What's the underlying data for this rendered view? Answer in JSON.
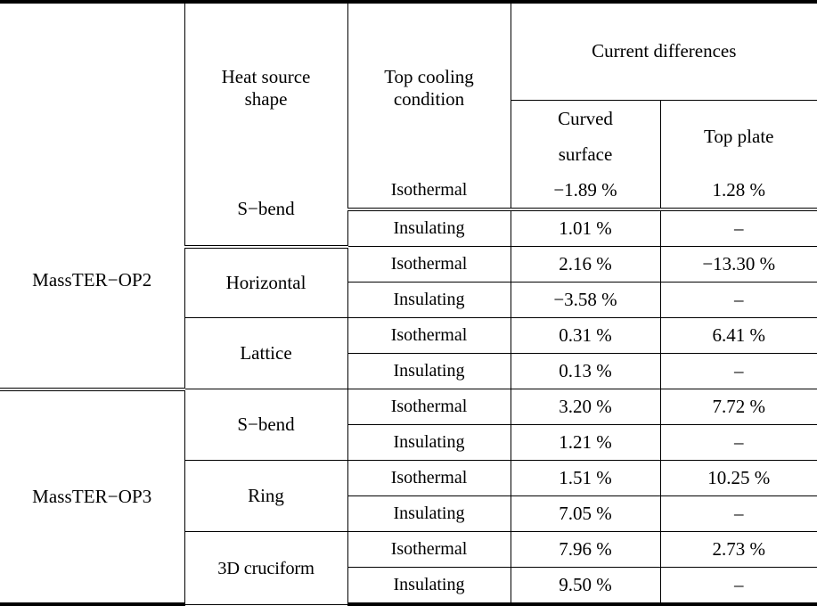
{
  "table": {
    "caption_present": false,
    "header": {
      "col_model": "",
      "col_shape": {
        "line1": "Heat  source",
        "line2": "shape"
      },
      "col_cooling": {
        "line1": "Top  cooling",
        "line2": "condition"
      },
      "group_current_differences": "Current  differences",
      "col_curved": {
        "line1": "Curved",
        "line2": "surface"
      },
      "col_topplate": "Top  plate"
    },
    "columns": [
      "",
      "Heat source shape",
      "Top cooling condition",
      "Current differences / Curved surface",
      "Current differences / Top plate"
    ],
    "dash_placeholder": "–",
    "groups": [
      {
        "model": "MassTER−OP2",
        "shapes": [
          {
            "shape": "S−bend",
            "rows": [
              {
                "cooling": "Isothermal",
                "curved_surface": "−1.89 %",
                "top_plate": "1.28 %"
              },
              {
                "cooling": "Insulating",
                "curved_surface": "1.01 %",
                "top_plate": "–"
              }
            ]
          },
          {
            "shape": "Horizontal",
            "rows": [
              {
                "cooling": "Isothermal",
                "curved_surface": "2.16 %",
                "top_plate": "−13.30 %"
              },
              {
                "cooling": "Insulating",
                "curved_surface": "−3.58 %",
                "top_plate": "–"
              }
            ]
          },
          {
            "shape": "Lattice",
            "rows": [
              {
                "cooling": "Isothermal",
                "curved_surface": "0.31 %",
                "top_plate": "6.41 %"
              },
              {
                "cooling": "Insulating",
                "curved_surface": "0.13 %",
                "top_plate": "–"
              }
            ]
          }
        ]
      },
      {
        "model": "MassTER−OP3",
        "shapes": [
          {
            "shape": "S−bend",
            "rows": [
              {
                "cooling": "Isothermal",
                "curved_surface": "3.20 %",
                "top_plate": "7.72 %"
              },
              {
                "cooling": "Insulating",
                "curved_surface": "1.21 %",
                "top_plate": "–"
              }
            ]
          },
          {
            "shape": "Ring",
            "rows": [
              {
                "cooling": "Isothermal",
                "curved_surface": "1.51 %",
                "top_plate": "10.25 %"
              },
              {
                "cooling": "Insulating",
                "curved_surface": "7.05 %",
                "top_plate": "–"
              }
            ]
          },
          {
            "shape": "3D  cruciform",
            "rows": [
              {
                "cooling": "Isothermal",
                "curved_surface": "7.96 %",
                "top_plate": "2.73 %"
              },
              {
                "cooling": "Insulating",
                "curved_surface": "9.50 %",
                "top_plate": "–"
              }
            ]
          }
        ]
      }
    ]
  }
}
